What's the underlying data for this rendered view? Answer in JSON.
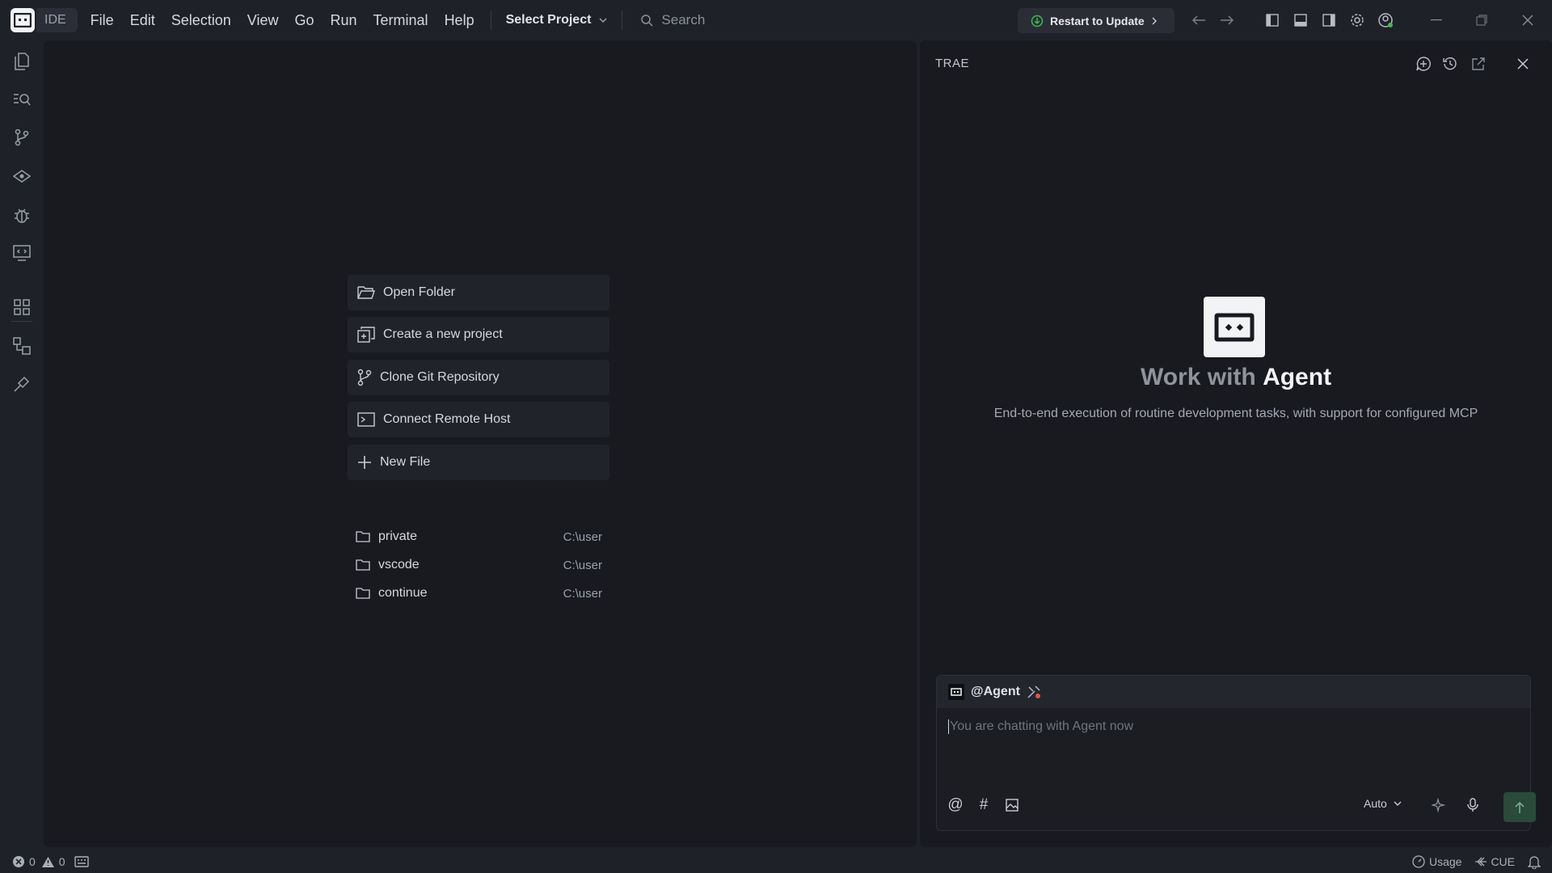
{
  "titlebar": {
    "app_badge": "IDE",
    "menu": [
      "File",
      "Edit",
      "Selection",
      "View",
      "Go",
      "Run",
      "Terminal",
      "Help"
    ],
    "project_select": "Select Project",
    "search_placeholder": "Search",
    "restart_label": "Restart to Update"
  },
  "editor": {
    "actions": [
      {
        "label": "Open Folder",
        "icon": "folder-open-icon"
      },
      {
        "label": "Create a new project",
        "icon": "new-project-icon"
      },
      {
        "label": "Clone Git Repository",
        "icon": "git-branch-icon"
      },
      {
        "label": "Connect Remote Host",
        "icon": "remote-terminal-icon"
      },
      {
        "label": "New File",
        "icon": "plus-icon"
      }
    ],
    "recent": [
      {
        "name": "private",
        "path": "C:\\user"
      },
      {
        "name": "vscode",
        "path": "C:\\user"
      },
      {
        "name": "continue",
        "path": "C:\\user"
      }
    ]
  },
  "panel": {
    "title": "TRAE",
    "heading_prefix": "Work with",
    "heading_emphasis": "Agent",
    "subtitle": "End-to-end execution of routine development tasks, with support for configured MCP",
    "chat_agent": "@Agent",
    "chat_placeholder": "You are chatting with Agent now",
    "model_select": "Auto"
  },
  "status": {
    "errors": "0",
    "warnings": "0",
    "usage": "Usage",
    "cue": "CUE"
  },
  "colors": {
    "background": "#1f2128",
    "surface": "#181a20",
    "accent_green": "#3fb950",
    "send_button": "#2a4a3a"
  }
}
